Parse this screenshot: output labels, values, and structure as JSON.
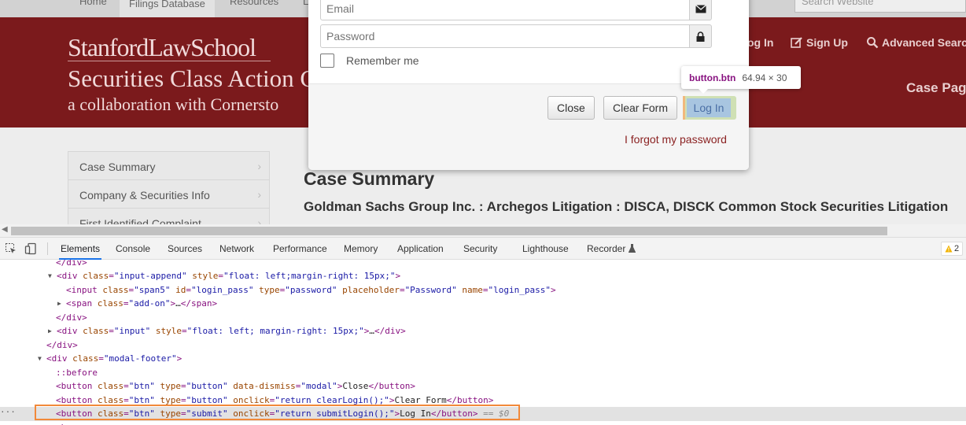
{
  "site": {
    "nav": [
      "Home",
      "Filings Database",
      "Resources",
      "L"
    ],
    "search_placeholder": "Search Website",
    "logo": {
      "line1": "StanfordLawSchool",
      "line2": "Securities Class Action C",
      "line3": "a collaboration with Cornersto"
    },
    "user_links": [
      "og In",
      "Sign Up",
      "Advanced Searc"
    ],
    "case_page": "Case Pag",
    "sidebar": [
      "Case Summary",
      "Company & Securities Info",
      "First Identified Complaint"
    ],
    "case_title": "Case Summary",
    "case_subtitle": "Goldman Sachs Group Inc. : Archegos Litigation : DISCA, DISCK Common Stock Securities Litigation"
  },
  "modal": {
    "email_placeholder": "Email",
    "password_placeholder": "Password",
    "remember_label": "Remember me",
    "buttons": {
      "close": "Close",
      "clear": "Clear Form",
      "login": "Log In"
    },
    "forgot_link": "I forgot my password"
  },
  "tooltip": {
    "tag": "button.btn",
    "dims": "64.94 × 30"
  },
  "devtools": {
    "tabs": [
      "Elements",
      "Console",
      "Sources",
      "Network",
      "Performance",
      "Memory",
      "Application",
      "Security",
      "Lighthouse",
      "Recorder"
    ],
    "active_tab": "Elements",
    "warnings": "2",
    "selected_suffix": "== $0"
  },
  "colors": {
    "banner": "#7b1a1c",
    "accent": "#1a73e8",
    "highlight": "#f2893a"
  }
}
